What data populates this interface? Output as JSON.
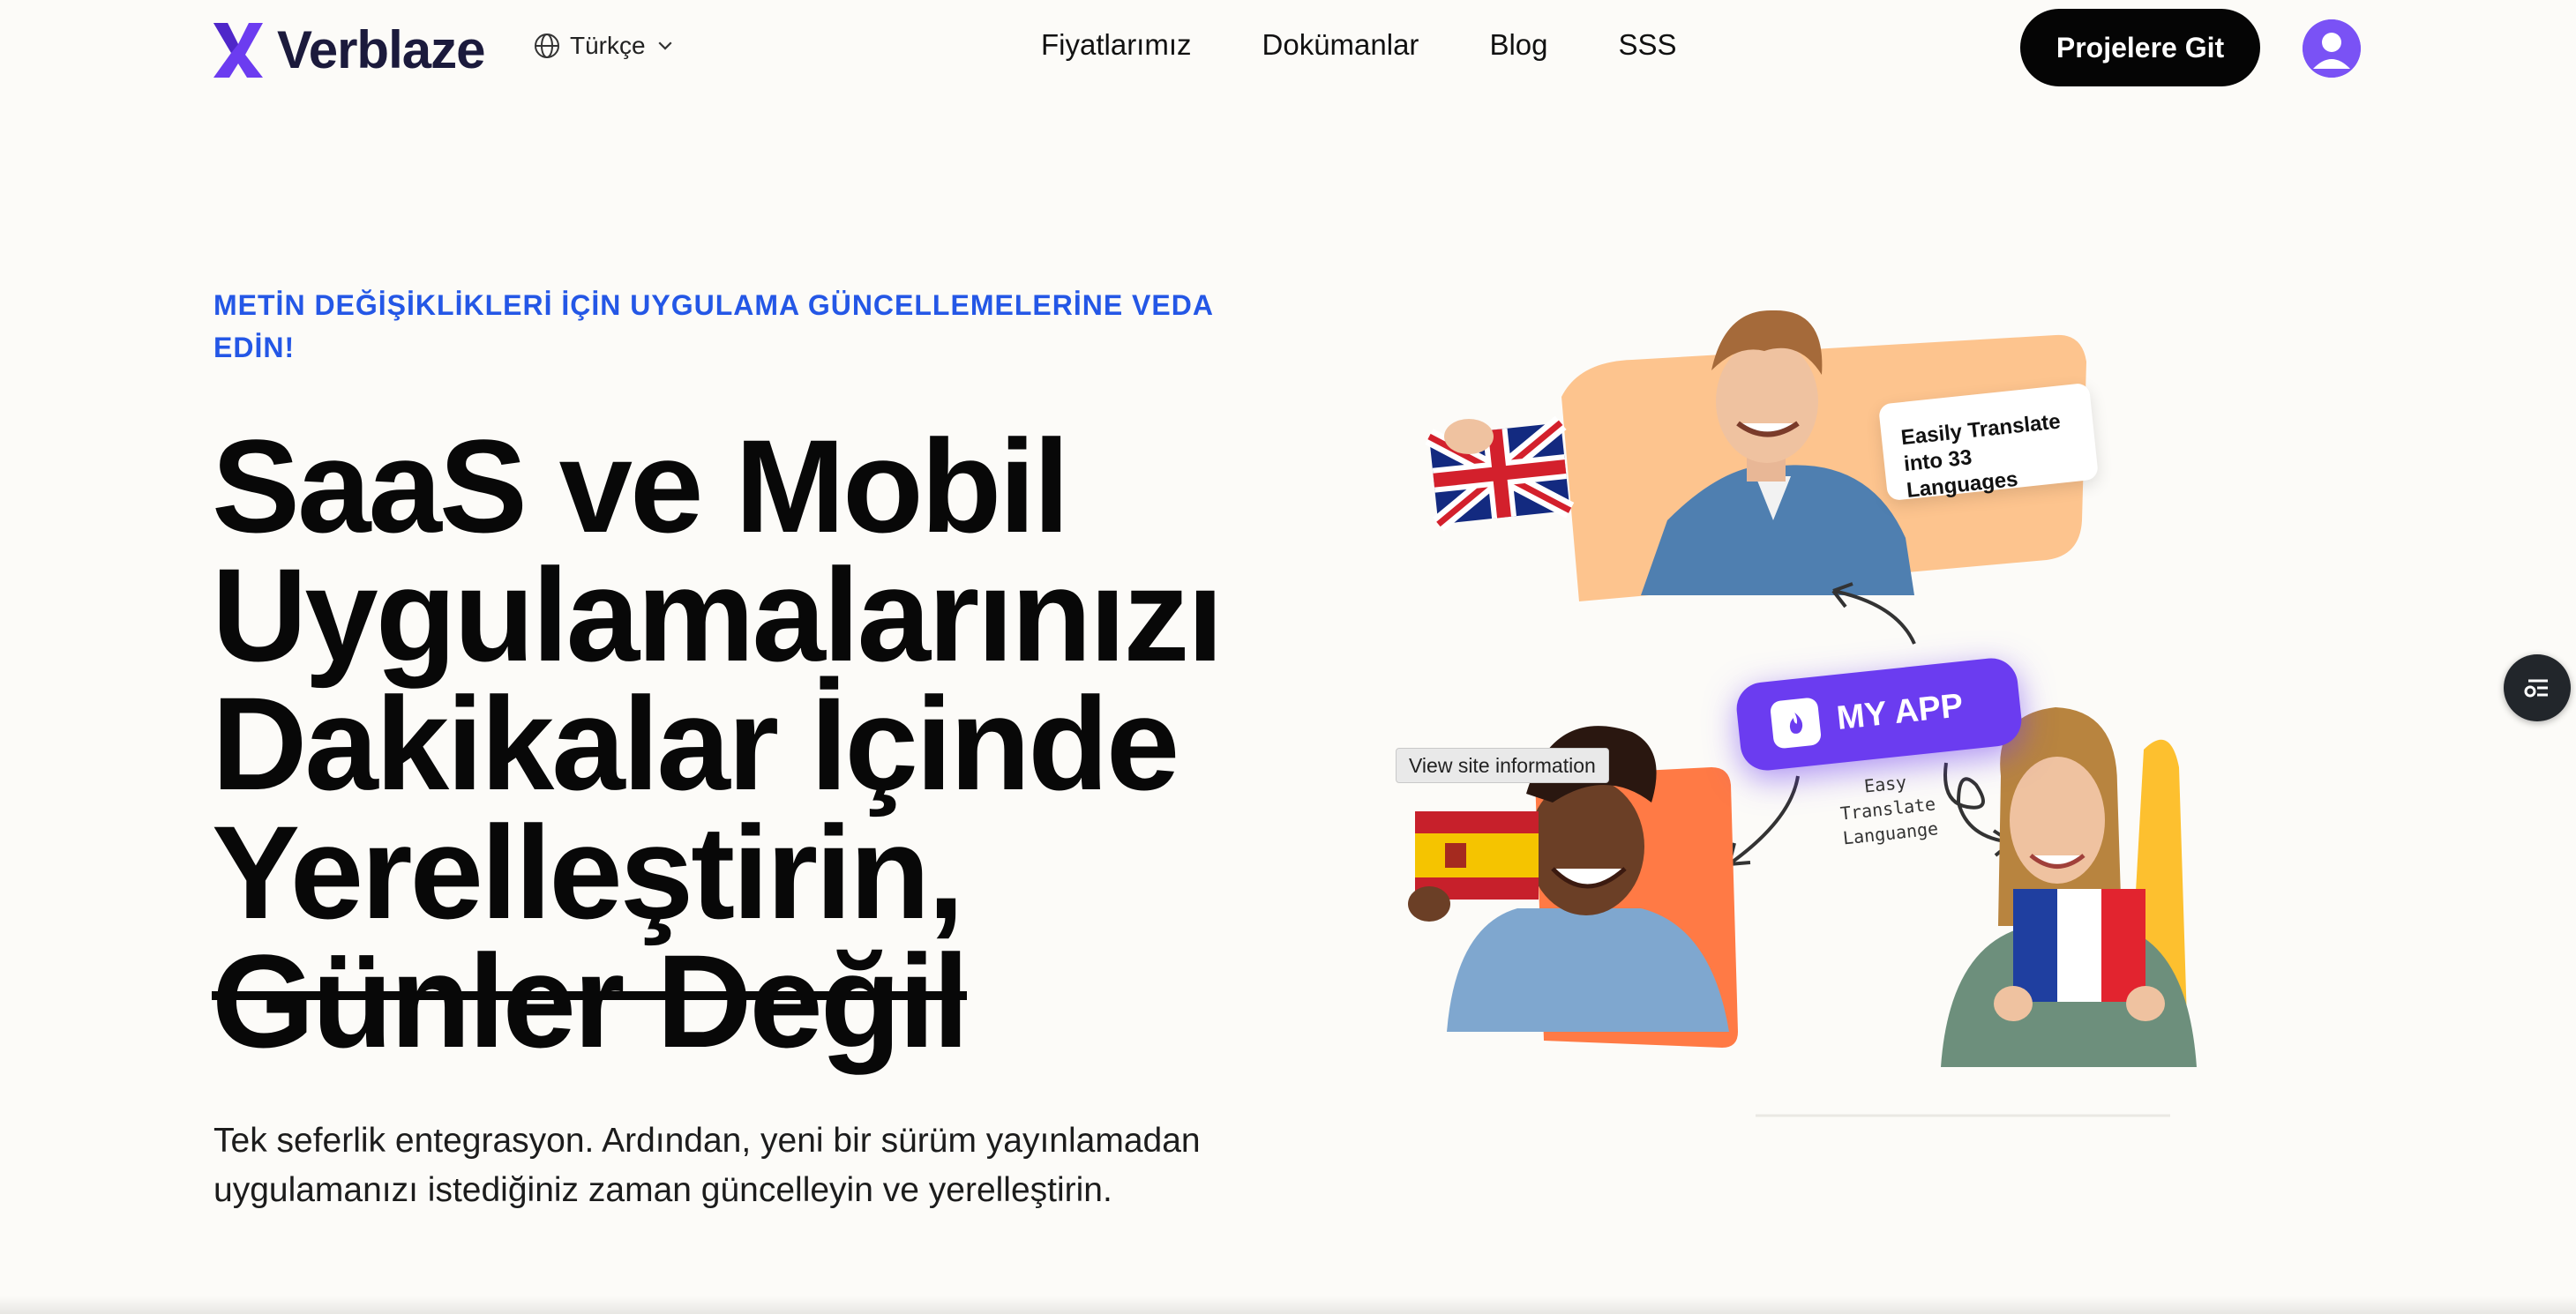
{
  "header": {
    "logo_text": "Verblaze",
    "language": "Türkçe",
    "nav": [
      "Fiyatlarımız",
      "Dokümanlar",
      "Blog",
      "SSS"
    ],
    "cta_label": "Projelere Git",
    "icons": {
      "logo": "verblaze-logo-icon",
      "language": "globe-icon",
      "dropdown": "chevron-down-icon",
      "user": "user-avatar-icon"
    }
  },
  "hero": {
    "eyebrow": "METİN DEĞİŞİKLİKLERİ İÇİN UYGULAMA GÜNCELLEMELERİNE VEDA EDİN!",
    "headline_lines": [
      "SaaS ve Mobil",
      "Uygulamalarınızı",
      "Dakikalar İçinde",
      "Yerelleştirin,"
    ],
    "headline_strike": "Günler Değil",
    "subtitle": "Tek seferlik entegrasyon. Ardından, yeni bir sürüm yayınlamadan uygulamanızı istediğiniz zaman güncelleyin ve yerelleştirin."
  },
  "illustration": {
    "card_text": "Easily Translate into 33 Languages",
    "app_label": "MY APP",
    "hand_note": "Easy Translate Languange",
    "tooltip": "View site information",
    "flags": [
      "uk-flag",
      "spain-flag",
      "france-flag"
    ]
  },
  "side_button_icon": "list-settings-icon",
  "colors": {
    "background": "#fcfbf8",
    "accent_blue": "#2457e6",
    "brand_purple": "#6b3cf0",
    "cta_black": "#050505",
    "peach": "#fdc48e",
    "orange": "#ff7a45",
    "yellow": "#fdc02f"
  }
}
